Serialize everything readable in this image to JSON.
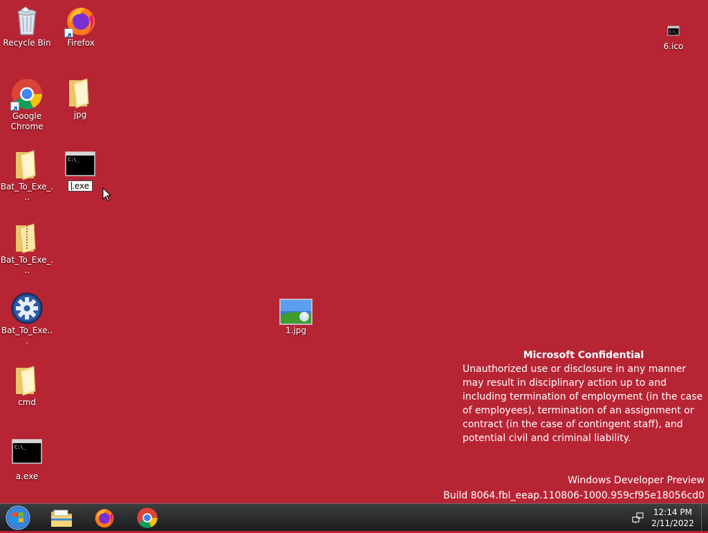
{
  "desktop": {
    "background": "#b72535",
    "icons": [
      {
        "label": "Recycle Bin",
        "icon": "recycle-bin-icon"
      },
      {
        "label": "Firefox",
        "icon": "firefox-icon"
      },
      {
        "label": "6.ico",
        "icon": "console-icon"
      },
      {
        "label": "Google Chrome",
        "icon": "chrome-icon"
      },
      {
        "label": "jpg",
        "icon": "folder-icon"
      },
      {
        "label": "Bat_To_Exe_...",
        "icon": "folder-icon"
      },
      {
        "label": ".exe",
        "icon": "console-icon"
      },
      {
        "label": "Bat_To_Exe_...",
        "icon": "zip-folder-icon"
      },
      {
        "label": "Bat_To_Exe...",
        "icon": "gear-icon"
      },
      {
        "label": "1.jpg",
        "icon": "image-thumbnail-icon"
      },
      {
        "label": "cmd",
        "icon": "folder-icon"
      },
      {
        "label": "a.exe",
        "icon": "console-icon"
      }
    ]
  },
  "confidential": {
    "title": "Microsoft Confidential",
    "text": "Unauthorized use or disclosure in any manner may result in disciplinary action up to and including termination of employment (in the case of employees), termination of an assignment or contract (in the case of contingent staff), and potential civil and criminal liability."
  },
  "watermark": {
    "line1": "Windows Developer Preview",
    "line2": "Build 8064.fbl_eeap.110806-1000.959cf95e18056cd0"
  },
  "taskbar": {
    "start": "start-orb-icon",
    "pinned": [
      "file-explorer-icon",
      "firefox-icon",
      "chrome-icon"
    ],
    "clock_time": "12:14 PM",
    "clock_date": "2/11/2022"
  }
}
